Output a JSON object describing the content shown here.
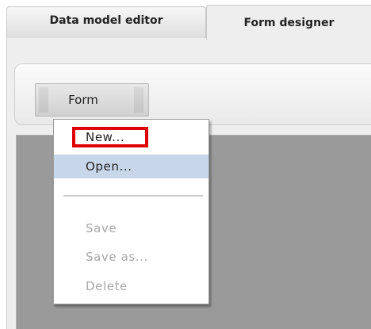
{
  "tabs": [
    {
      "label": "Data model editor",
      "active": false
    },
    {
      "label": "Form designer",
      "active": true
    }
  ],
  "toolbar": {
    "form_button_label": "Form"
  },
  "menu": {
    "items": [
      {
        "label": "New...",
        "enabled": true
      },
      {
        "label": "Open...",
        "enabled": true,
        "hovered": true
      },
      {
        "label": "Save",
        "enabled": false
      },
      {
        "label": "Save as...",
        "enabled": false
      },
      {
        "label": "Delete",
        "enabled": false
      }
    ]
  },
  "colors": {
    "highlight": "#e00000",
    "hover": "#c8d6ea",
    "disabled_text": "#a8a8a8",
    "workspace": "#9a9a9a"
  }
}
